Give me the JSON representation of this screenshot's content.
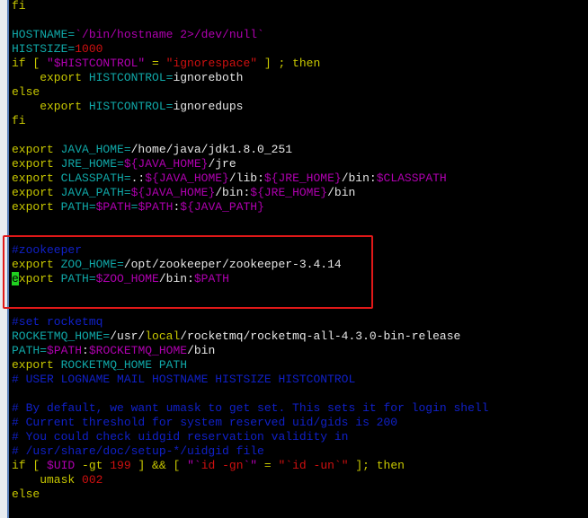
{
  "colors": {
    "keyword": "#c8c800",
    "variable": "#10a8a8",
    "string": "#b000b0",
    "number": "#d01010",
    "comment": "#1020c8",
    "highlight_box": "#e01818",
    "cursor": "#20d020"
  },
  "lines": [
    [
      [
        "kw",
        "fi"
      ]
    ],
    [],
    [
      [
        "var",
        "HOSTNAME="
      ],
      [
        "str",
        "`/bin/hostname 2>/dev/null`"
      ]
    ],
    [
      [
        "var",
        "HISTSIZE="
      ],
      [
        "num",
        "1000"
      ]
    ],
    [
      [
        "kw",
        "if [ "
      ],
      [
        "str",
        "\"$HISTCONTROL\""
      ],
      [
        "kw",
        " = "
      ],
      [
        "num",
        "\"ignorespace\""
      ],
      [
        "kw",
        " ] ; then"
      ]
    ],
    [
      [
        "kw",
        "    export "
      ],
      [
        "var",
        "HISTCONTROL="
      ],
      [
        "txt",
        "ignoreboth"
      ]
    ],
    [
      [
        "kw",
        "else"
      ]
    ],
    [
      [
        "kw",
        "    export "
      ],
      [
        "var",
        "HISTCONTROL="
      ],
      [
        "txt",
        "ignoredups"
      ]
    ],
    [
      [
        "kw",
        "fi"
      ]
    ],
    [],
    [
      [
        "kw",
        "export "
      ],
      [
        "var",
        "JAVA_HOME="
      ],
      [
        "txt",
        "/home/java/jdk1.8.0_251"
      ]
    ],
    [
      [
        "kw",
        "export "
      ],
      [
        "var",
        "JRE_HOME="
      ],
      [
        "str",
        "${JAVA_HOME}"
      ],
      [
        "txt",
        "/jre"
      ]
    ],
    [
      [
        "kw",
        "export "
      ],
      [
        "var",
        "CLASSPATH="
      ],
      [
        "txt",
        ".:"
      ],
      [
        "str",
        "${JAVA_HOME}"
      ],
      [
        "txt",
        "/lib:"
      ],
      [
        "str",
        "${JRE_HOME}"
      ],
      [
        "txt",
        "/bin:"
      ],
      [
        "str",
        "$CLASSPATH"
      ]
    ],
    [
      [
        "kw",
        "export "
      ],
      [
        "var",
        "JAVA_PATH="
      ],
      [
        "str",
        "${JAVA_HOME}"
      ],
      [
        "txt",
        "/bin:"
      ],
      [
        "str",
        "${JRE_HOME}"
      ],
      [
        "txt",
        "/bin"
      ]
    ],
    [
      [
        "kw",
        "export "
      ],
      [
        "var",
        "PATH="
      ],
      [
        "str",
        "$PATH"
      ],
      [
        "var",
        "="
      ],
      [
        "str",
        "$PATH"
      ],
      [
        "txt",
        ":"
      ],
      [
        "str",
        "${JAVA_PATH}"
      ]
    ],
    [],
    [],
    [
      [
        "cmt",
        "#zookeeper"
      ]
    ],
    [
      [
        "kw",
        "export "
      ],
      [
        "var",
        "ZOO_HOME="
      ],
      [
        "txt",
        "/opt/zookeeper/zookeeper-3.4.14"
      ]
    ],
    [
      [
        "cursor",
        "e"
      ],
      [
        "kw",
        "xport "
      ],
      [
        "var",
        "PATH="
      ],
      [
        "str",
        "$ZOO_HOME"
      ],
      [
        "txt",
        "/bin:"
      ],
      [
        "str",
        "$PATH"
      ]
    ],
    [],
    [],
    [
      [
        "cmt",
        "#set rocketmq"
      ]
    ],
    [
      [
        "var",
        "ROCKETMQ_HOME="
      ],
      [
        "txt",
        "/usr/"
      ],
      [
        "kw",
        "local"
      ],
      [
        "txt",
        "/rocketmq/rocketmq-all-4.3.0-bin-release"
      ]
    ],
    [
      [
        "var",
        "PATH="
      ],
      [
        "str",
        "$PATH"
      ],
      [
        "txt",
        ":"
      ],
      [
        "str",
        "$ROCKETMQ_HOME"
      ],
      [
        "txt",
        "/bin"
      ]
    ],
    [
      [
        "kw",
        "export "
      ],
      [
        "var",
        "ROCKETMQ_HOME PATH"
      ]
    ],
    [
      [
        "cmt",
        "# USER LOGNAME MAIL HOSTNAME HISTSIZE HISTCONTROL"
      ]
    ],
    [],
    [
      [
        "cmt",
        "# By default, we want umask to get set. This sets it for login shell"
      ]
    ],
    [
      [
        "cmt",
        "# Current threshold for system reserved uid/gids is 200"
      ]
    ],
    [
      [
        "cmt",
        "# You could check uidgid reservation validity in"
      ]
    ],
    [
      [
        "cmt",
        "# /usr/share/doc/setup-*/uidgid file"
      ]
    ],
    [
      [
        "kw",
        "if [ "
      ],
      [
        "str",
        "$UID"
      ],
      [
        "kw",
        " -gt "
      ],
      [
        "num",
        "199"
      ],
      [
        "kw",
        " ] && [ "
      ],
      [
        "str",
        "\"`"
      ],
      [
        "num",
        "id -gn"
      ],
      [
        "str",
        "`\""
      ],
      [
        "kw",
        " = "
      ],
      [
        "num",
        "\"`id -un`\""
      ],
      [
        "kw",
        " ]; then"
      ]
    ],
    [
      [
        "kw",
        "    umask "
      ],
      [
        "num",
        "002"
      ]
    ],
    [
      [
        "kw",
        "else"
      ]
    ]
  ]
}
